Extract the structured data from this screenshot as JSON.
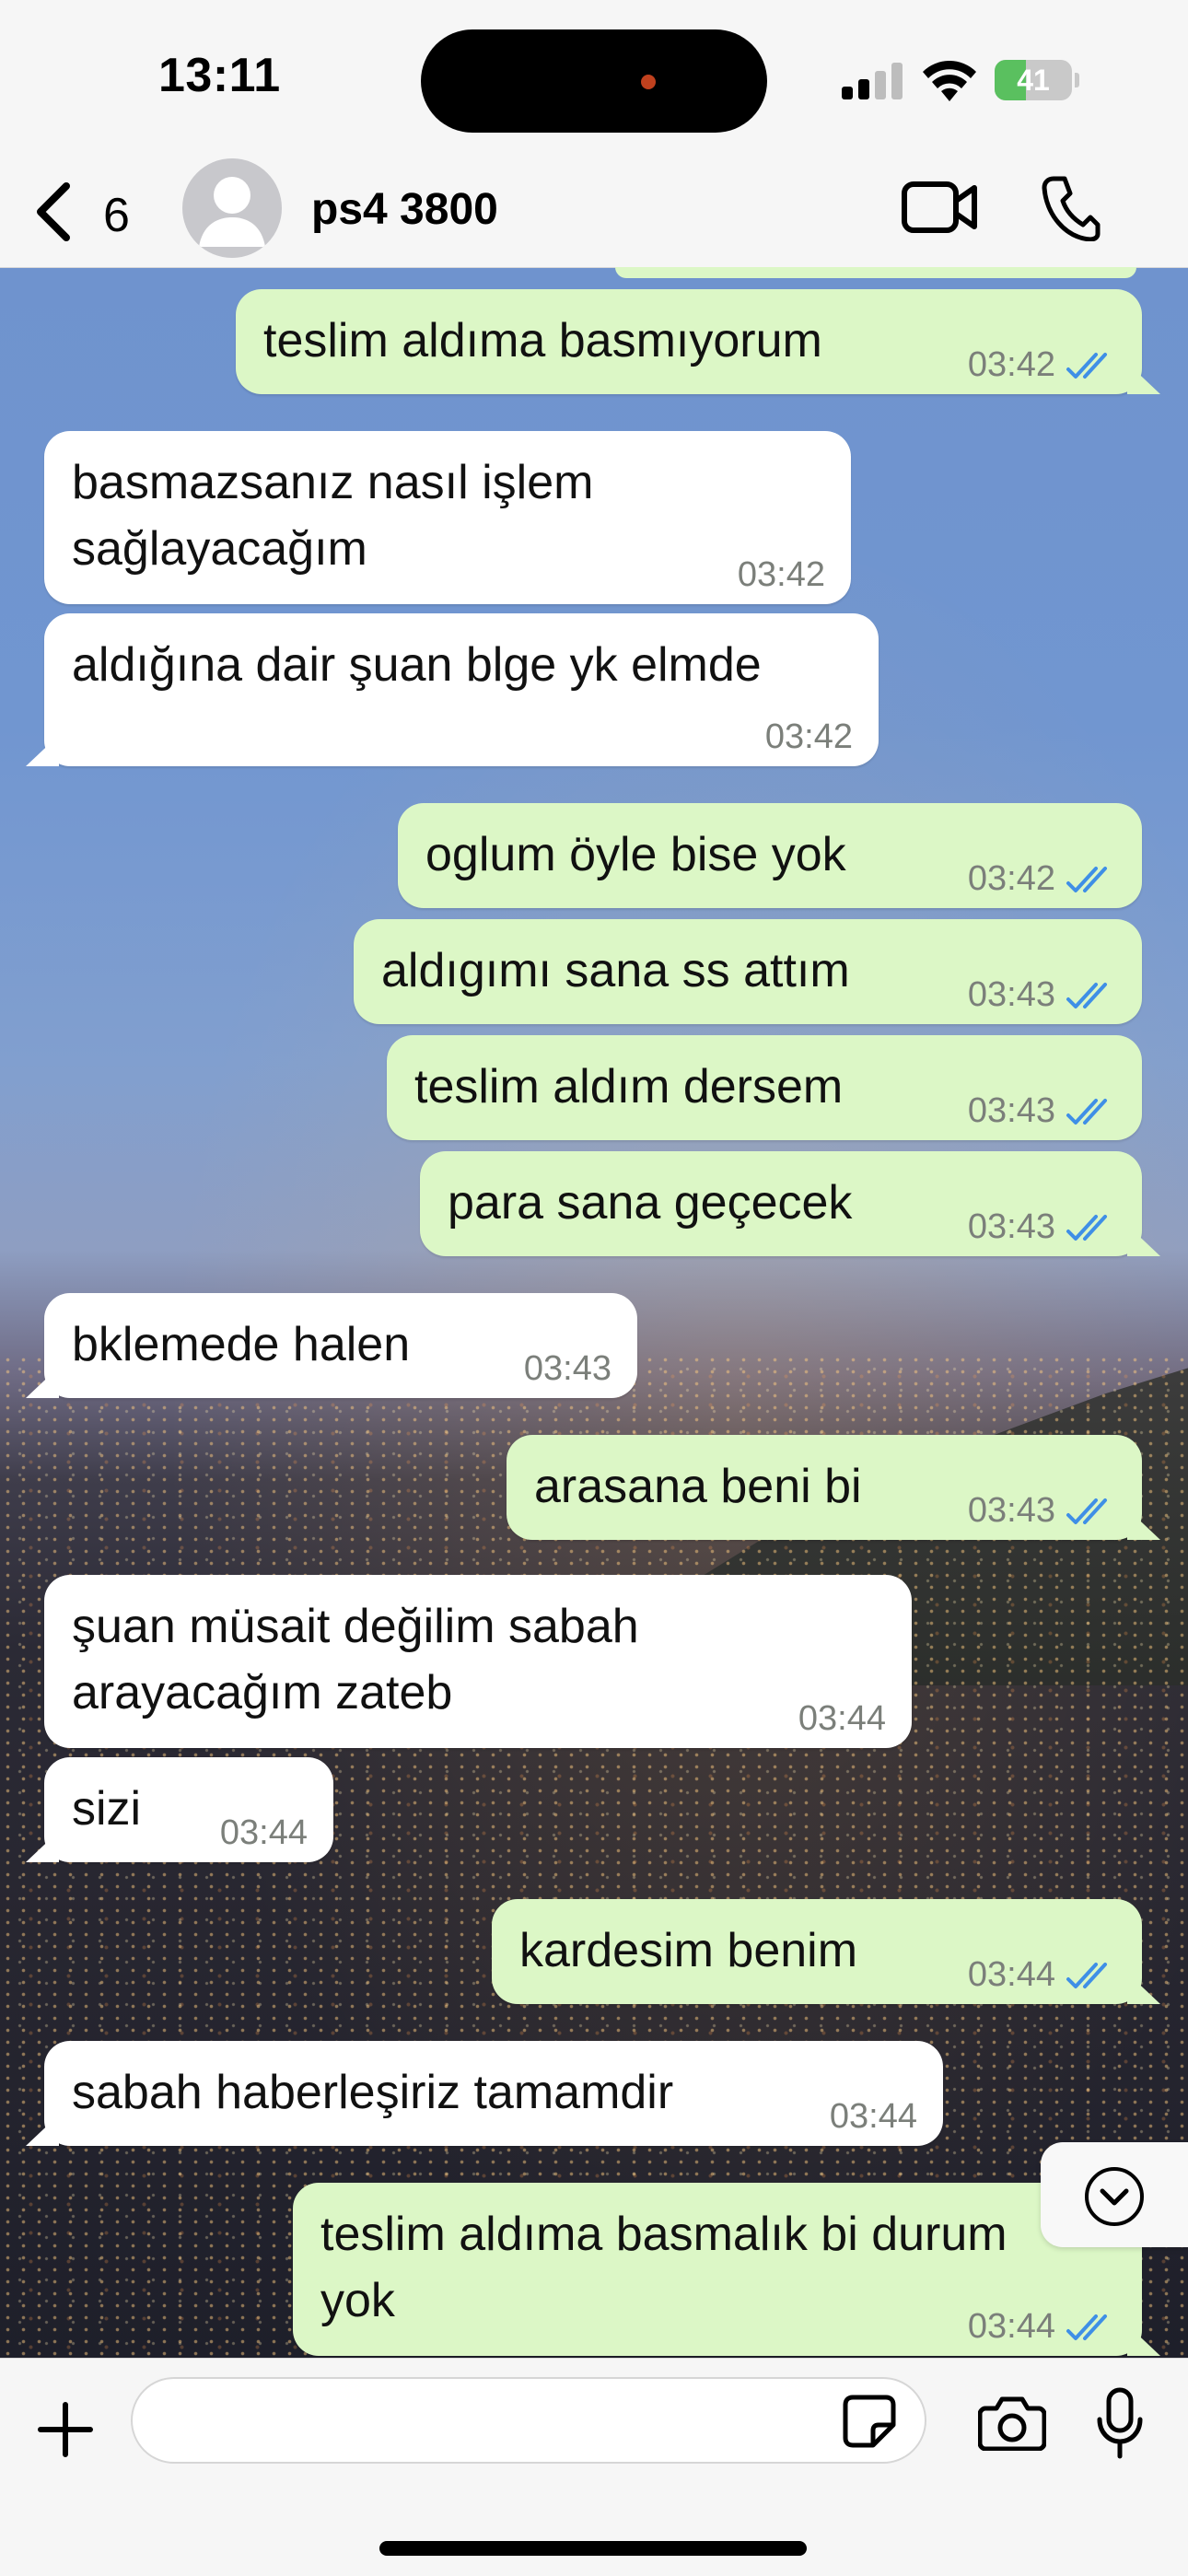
{
  "status_bar": {
    "time": "13:11",
    "battery": "41",
    "battery_level": 0.41,
    "icons": [
      "signal-icon",
      "wifi-icon",
      "battery-charging-icon"
    ]
  },
  "header": {
    "back_count": "6",
    "contact_name": "ps4 3800",
    "icons": [
      "back-chevron-icon",
      "avatar-placeholder-icon",
      "video-camera-icon",
      "phone-icon"
    ]
  },
  "messages": [
    {
      "direction": "out",
      "text": "teslim aldıma basmıyorum",
      "time": "03:42",
      "read": true
    },
    {
      "direction": "in",
      "text": "basmazsanız nasıl işlem\nsağlayacağım",
      "time": "03:42"
    },
    {
      "direction": "in",
      "text": "aldığına dair şuan blge yk elmde",
      "time": "03:42"
    },
    {
      "direction": "out",
      "text": "oglum öyle bise yok",
      "time": "03:42",
      "read": true
    },
    {
      "direction": "out",
      "text": "aldıgımı sana ss attım",
      "time": "03:43",
      "read": true
    },
    {
      "direction": "out",
      "text": "teslim aldım dersem",
      "time": "03:43",
      "read": true
    },
    {
      "direction": "out",
      "text": "para sana geçecek",
      "time": "03:43",
      "read": true
    },
    {
      "direction": "in",
      "text": "bklemede halen",
      "time": "03:43"
    },
    {
      "direction": "out",
      "text": "arasana beni bi",
      "time": "03:43",
      "read": true
    },
    {
      "direction": "in",
      "text": "şuan müsait değilim sabah\narayacağım zateb",
      "time": "03:44"
    },
    {
      "direction": "in",
      "text": "sizi",
      "time": "03:44"
    },
    {
      "direction": "out",
      "text": "kardesim benim",
      "time": "03:44",
      "read": true
    },
    {
      "direction": "in",
      "text": "sabah haberleşiriz tamamdir",
      "time": "03:44"
    },
    {
      "direction": "out",
      "text": "teslim aldıma basmalık bi durum\nyok",
      "time": "03:44",
      "read": true
    }
  ],
  "input_bar": {
    "message_value": "",
    "icons": [
      "plus-icon",
      "sticker-icon",
      "camera-icon",
      "microphone-icon"
    ]
  },
  "scroll_button": {
    "icon": "chevron-down-circle-icon"
  },
  "colors": {
    "outgoing_bubble": "#dcf7c6",
    "incoming_bubble": "#ffffff",
    "read_ticks": "#3f8fe6",
    "battery_green": "#5ac05f"
  }
}
